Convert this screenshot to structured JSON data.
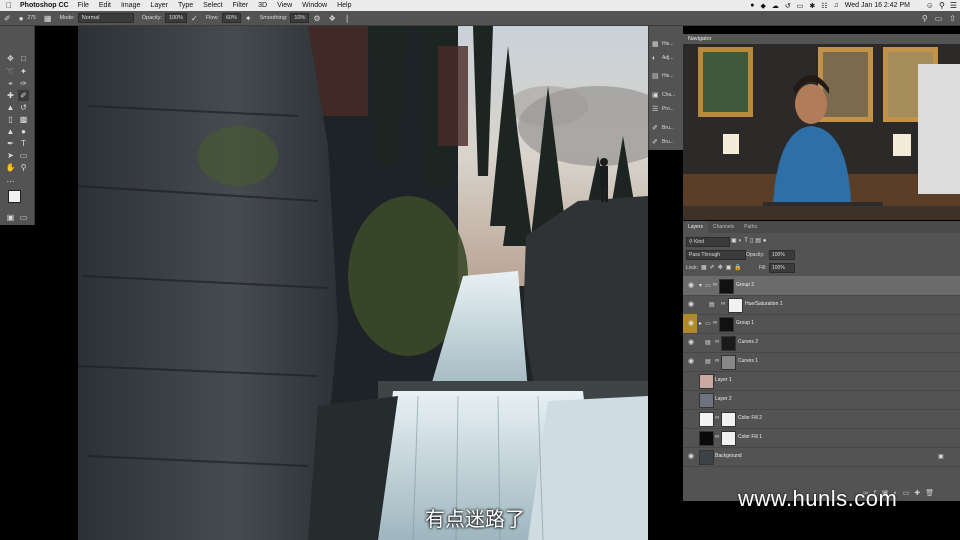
{
  "menubar": {
    "app_name": "Photoshop CC",
    "items": [
      "File",
      "Edit",
      "Image",
      "Layer",
      "Type",
      "Select",
      "Filter",
      "3D",
      "View",
      "Window",
      "Help"
    ],
    "datetime": "Wed Jan 16  2:42 PM"
  },
  "options": {
    "mode_label": "Mode:",
    "mode_value": "Normal",
    "opacity_label": "Opacity:",
    "opacity_value": "100%",
    "flow_label": "Flow:",
    "flow_value": "60%",
    "smoothing_label": "Smoothing:",
    "smoothing_value": "10%",
    "brush_size": "275"
  },
  "dock": {
    "items": [
      "His...",
      "Adj...",
      "His...",
      "Cha...",
      "Pro...",
      "Bru...",
      "Bru..."
    ]
  },
  "navigator": {
    "title": "Navigator"
  },
  "layers_panel": {
    "tabs": [
      "Layers",
      "Channels",
      "Paths"
    ],
    "kind_label": "Kind",
    "blend_mode": "Pass Through",
    "opacity_label": "Opacity:",
    "opacity_value": "100%",
    "lock_label": "Lock:",
    "fill_label": "Fill:",
    "fill_value": "100%",
    "layers": [
      {
        "name": "Group 2"
      },
      {
        "name": "Hue/Saturation 1"
      },
      {
        "name": "Group 1"
      },
      {
        "name": "Curves 2"
      },
      {
        "name": "Curves 1"
      },
      {
        "name": "Layer 1"
      },
      {
        "name": "Layer 2"
      },
      {
        "name": "Color Fill 2"
      },
      {
        "name": "Color Fill 1"
      },
      {
        "name": "Background"
      }
    ]
  },
  "overlay": {
    "watermark": "www.hunls.com",
    "subtitle": "有点迷路了"
  },
  "colors": {
    "panel_bg": "#535353",
    "selected_row": "#6b6b6b",
    "eye_highlight": "#b08a28"
  }
}
